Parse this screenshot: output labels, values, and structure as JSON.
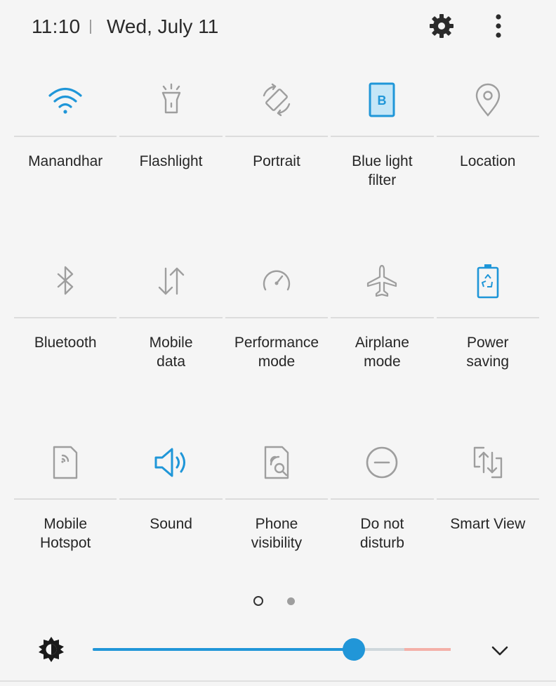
{
  "status": {
    "time": "11:10",
    "separator": "|",
    "date": "Wed, July 11"
  },
  "colors": {
    "accent": "#1f96d8",
    "inactive_icon": "#9e9e9e",
    "text": "#262626",
    "background": "#f5f5f5"
  },
  "tiles": [
    {
      "label": "Manandhar",
      "icon": "wifi-icon",
      "active": true
    },
    {
      "label": "Flashlight",
      "icon": "flashlight-icon",
      "active": false
    },
    {
      "label": "Portrait",
      "icon": "rotation-lock-icon",
      "active": false
    },
    {
      "label": "Blue light\nfilter",
      "icon": "blue-light-filter-icon",
      "active": true
    },
    {
      "label": "Location",
      "icon": "location-pin-icon",
      "active": false
    },
    {
      "label": "Bluetooth",
      "icon": "bluetooth-icon",
      "active": false
    },
    {
      "label": "Mobile\ndata",
      "icon": "mobile-data-icon",
      "active": false
    },
    {
      "label": "Performance\nmode",
      "icon": "speedometer-icon",
      "active": false
    },
    {
      "label": "Airplane\nmode",
      "icon": "airplane-icon",
      "active": false
    },
    {
      "label": "Power\nsaving",
      "icon": "battery-recycle-icon",
      "active": true
    },
    {
      "label": "Mobile\nHotspot",
      "icon": "hotspot-icon",
      "active": false
    },
    {
      "label": "Sound",
      "icon": "speaker-icon",
      "active": true
    },
    {
      "label": "Phone\nvisibility",
      "icon": "phone-visibility-icon",
      "active": false
    },
    {
      "label": "Do not\ndisturb",
      "icon": "do-not-disturb-icon",
      "active": false
    },
    {
      "label": "Smart View",
      "icon": "smart-view-icon",
      "active": false
    }
  ],
  "pager": {
    "current_page": 1,
    "total_pages": 2
  },
  "brightness": {
    "level_fraction": 0.73,
    "icon": "brightness-icon"
  },
  "header_icons": [
    "settings-gear-icon",
    "more-vertical-icon"
  ],
  "expand_icon": "chevron-down-icon"
}
